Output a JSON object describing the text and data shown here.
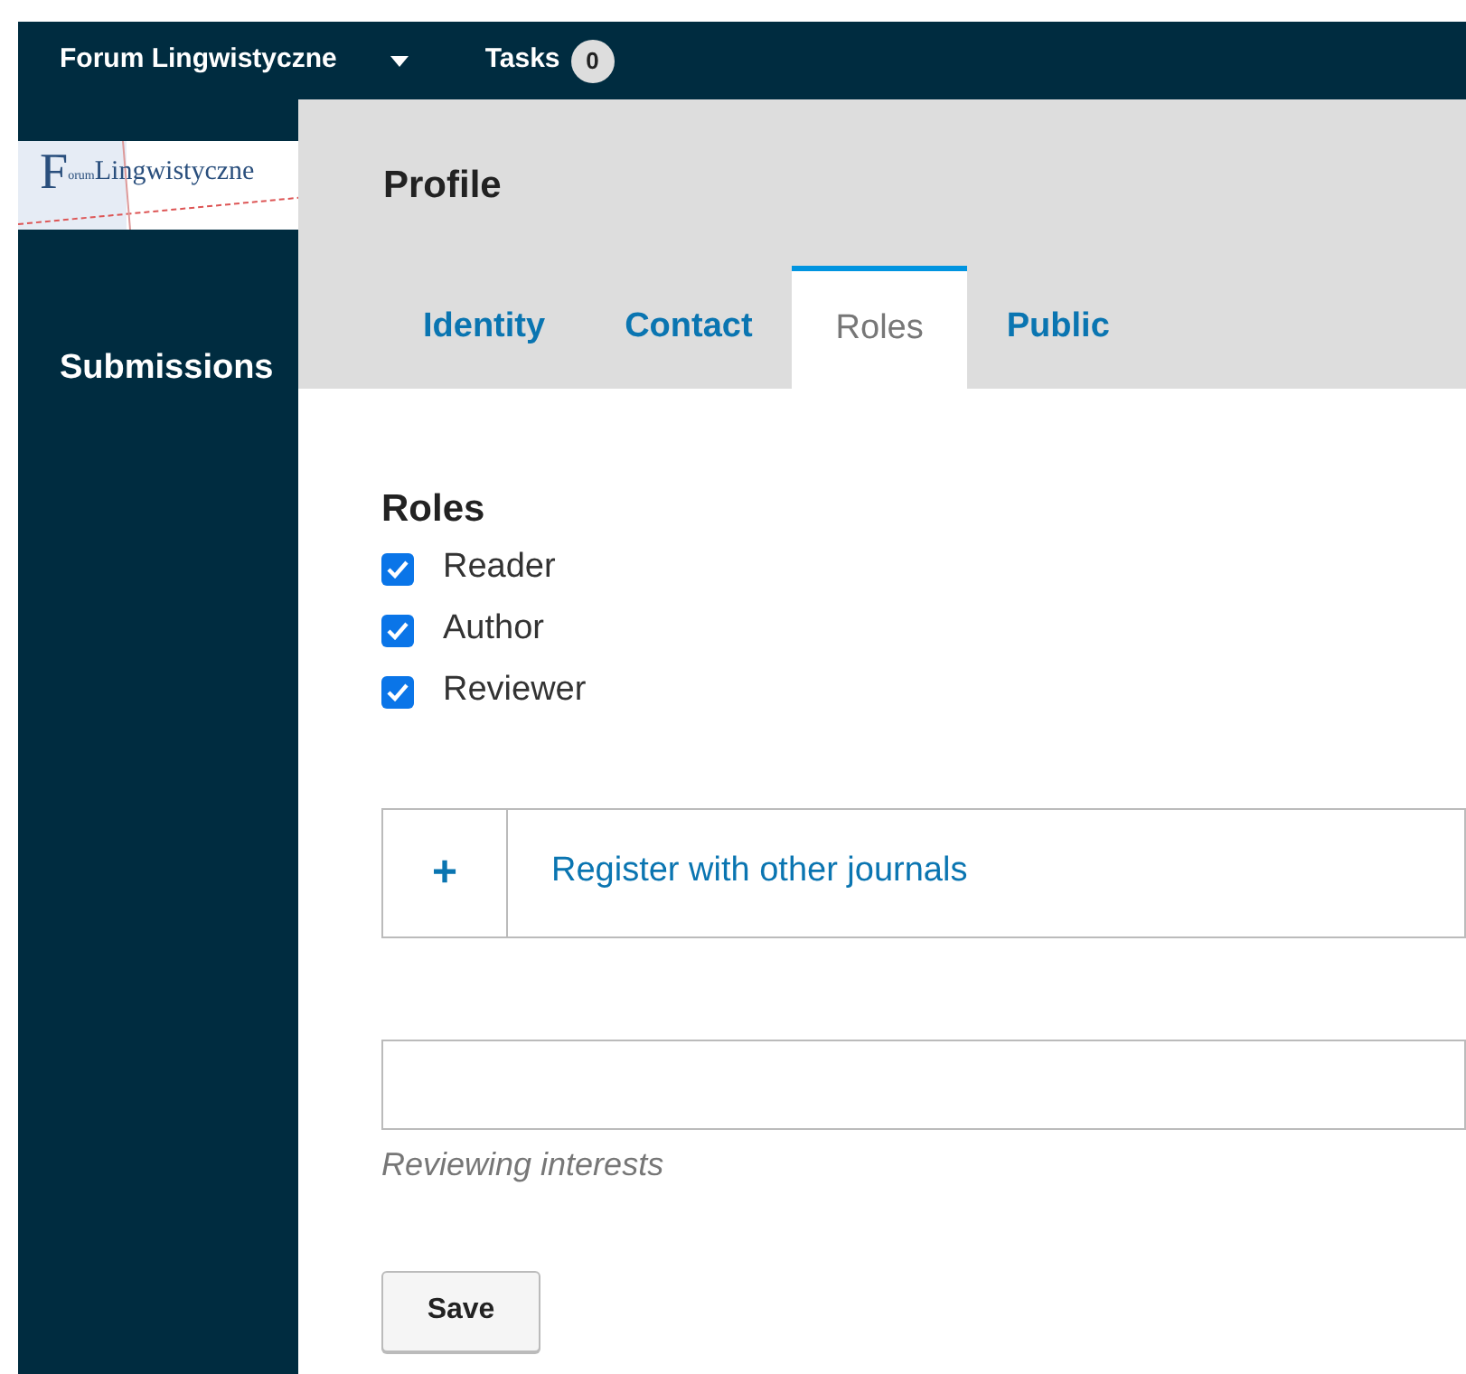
{
  "top_bar": {
    "site_name": "Forum Lingwistyczne",
    "tasks_label": "Tasks",
    "tasks_count": "0"
  },
  "logo": {
    "initial": "F",
    "small": "orum",
    "name": "Lingwistyczne"
  },
  "sidebar": {
    "items": [
      {
        "label": "Submissions"
      }
    ]
  },
  "page": {
    "title": "Profile",
    "tabs": [
      {
        "label": "Identity",
        "selected": false
      },
      {
        "label": "Contact",
        "selected": false
      },
      {
        "label": "Roles",
        "selected": true
      },
      {
        "label": "Public",
        "selected": false
      }
    ],
    "roles": {
      "heading": "Roles",
      "items": [
        {
          "label": "Reader",
          "checked": true
        },
        {
          "label": "Author",
          "checked": true
        },
        {
          "label": "Reviewer",
          "checked": true
        }
      ]
    },
    "register": {
      "icon": "+",
      "label": "Register with other journals"
    },
    "interests": {
      "hint": "Reviewing interests"
    },
    "save": "Save"
  }
}
